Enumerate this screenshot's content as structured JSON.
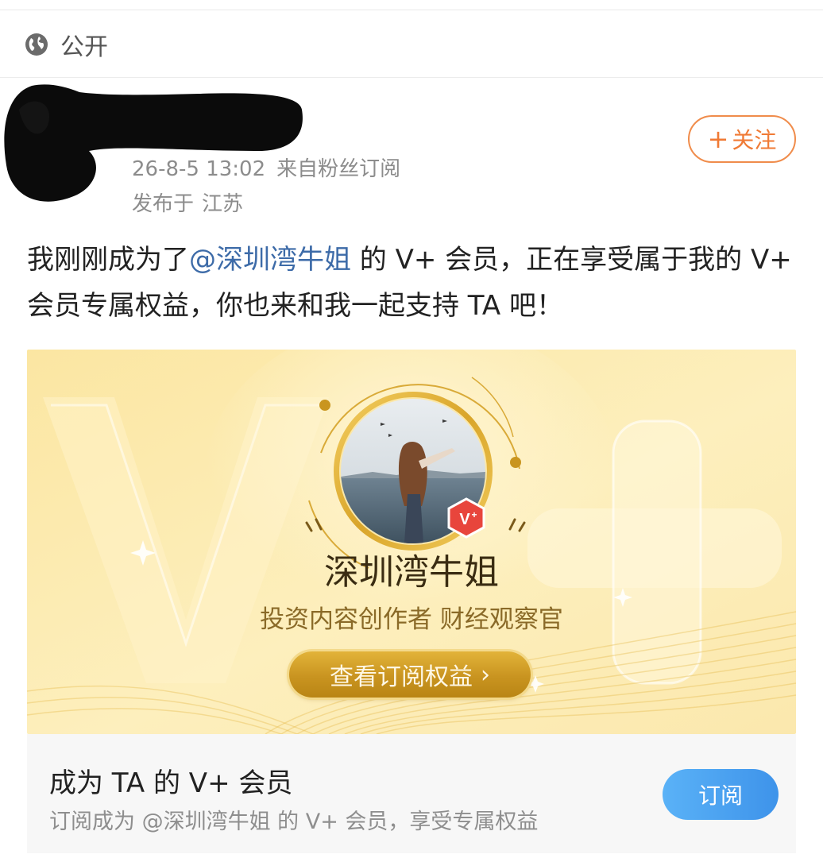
{
  "header": {
    "visibility_icon": "globe-icon",
    "visibility_label": "公开"
  },
  "post": {
    "timestamp": "26-8-5 13:02",
    "source": "来自粉丝订阅",
    "location_prefix": "发布于",
    "location": "江苏",
    "follow_label": "关注",
    "follow_icon": "plus-icon",
    "text_before": "我刚刚成为了",
    "mention": "@深圳湾牛姐",
    "text_after": " 的 V+ 会员，正在享受属于我的 V+ 会员专属权益，你也来和我一起支持 TA 吧！"
  },
  "card": {
    "name": "深圳湾牛姐",
    "role": "投资内容创作者 财经观察官",
    "button_label": "查看订阅权益",
    "badge_icon": "vplus-badge-icon"
  },
  "subscribe": {
    "title": "成为 TA 的 V+ 会员",
    "description": "订阅成为 @深圳湾牛姐 的 V+ 会员，享受专属权益",
    "button_label": "订阅"
  },
  "colors": {
    "accent_orange": "#f07a35",
    "mention_blue": "#3d6ba8",
    "subscribe_blue": "#3e93ea",
    "gold": "#c99420"
  }
}
